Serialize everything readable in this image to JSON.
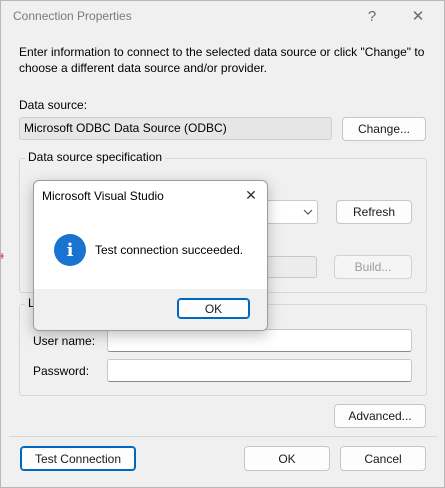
{
  "window": {
    "title": "Connection Properties",
    "help_icon": "?",
    "close_icon": "✕"
  },
  "intro_text": "Enter information to connect to the selected data source or click \"Change\" to choose a different data source and/or provider.",
  "data_source": {
    "label": "Data source:",
    "value": "Microsoft ODBC Data Source (ODBC)",
    "change_button": "Change..."
  },
  "spec_group": {
    "label": "Data source specification",
    "refresh_button": "Refresh",
    "build_button": "Build..."
  },
  "login": {
    "label_fragment": "L",
    "username_label": "User name:",
    "username_value": "",
    "password_label": "Password:",
    "password_value": ""
  },
  "buttons": {
    "advanced": "Advanced...",
    "test_connection": "Test Connection",
    "ok": "OK",
    "cancel": "Cancel"
  },
  "message_box": {
    "title": "Microsoft Visual Studio",
    "close_icon": "✕",
    "info_icon": "i",
    "message": "Test connection succeeded.",
    "ok_button": "OK"
  },
  "colors": {
    "accent": "#0067c0",
    "info_icon": "#1874d0"
  }
}
